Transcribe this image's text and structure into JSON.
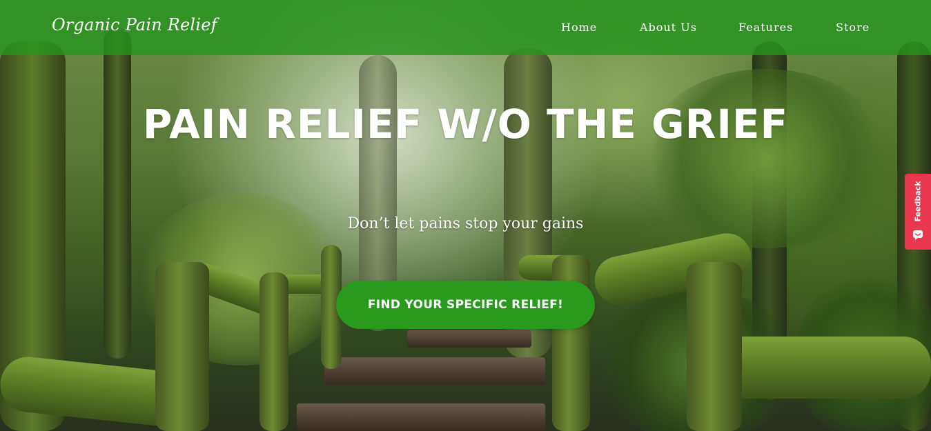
{
  "navbar": {
    "logo": "Organic Pain Relief",
    "links": [
      {
        "label": "Home"
      },
      {
        "label": "About Us"
      },
      {
        "label": "Features"
      },
      {
        "label": "Store"
      }
    ]
  },
  "hero": {
    "headline": "PAIN RELIEF W/O THE GRIEF",
    "subheadline": "Don’t let pains stop your gains",
    "cta_label": "FIND YOUR SPECIFIC RELIEF!"
  },
  "feedback": {
    "label": "Feedback",
    "color": "#e8374f"
  },
  "colors": {
    "brand_green": "#2a9a1e",
    "navbar_green": "#26941e",
    "text_white": "#ffffff"
  }
}
